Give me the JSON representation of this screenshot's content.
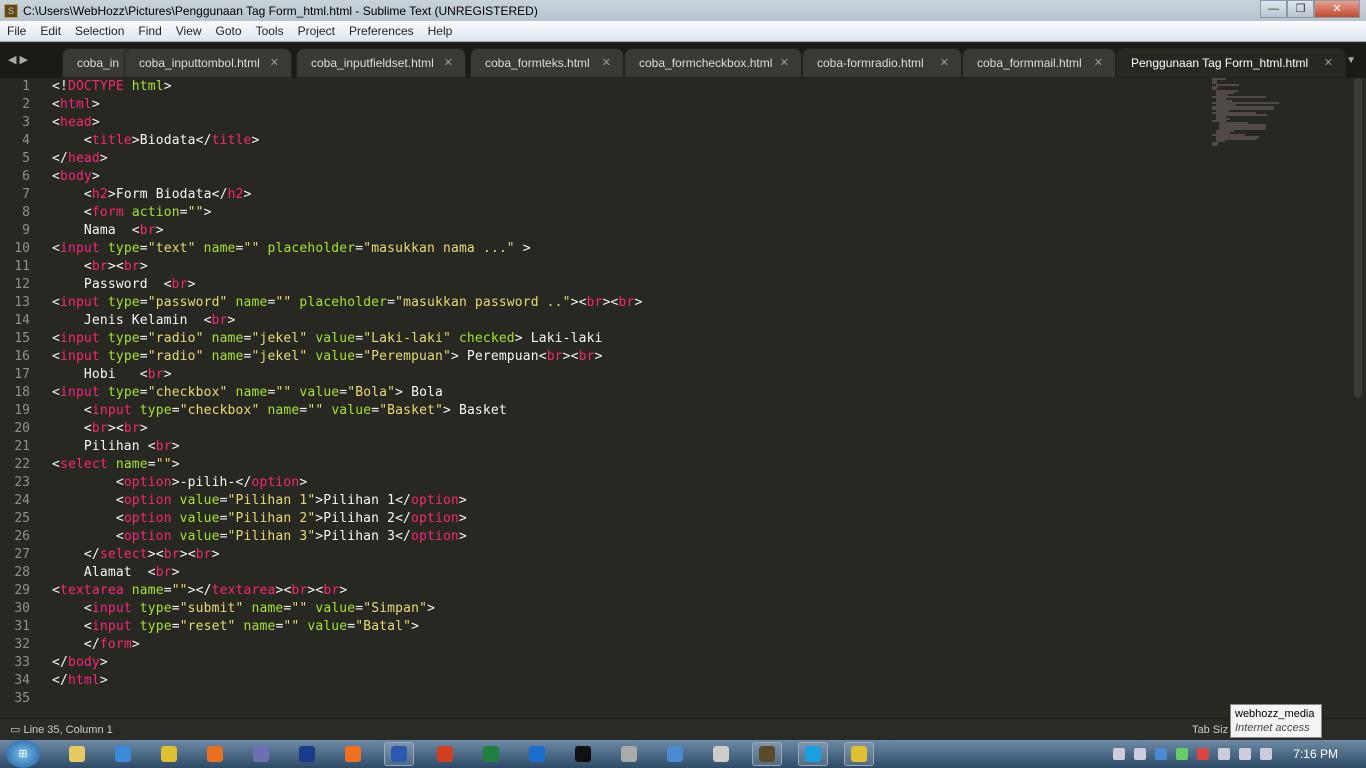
{
  "window": {
    "title": "C:\\Users\\WebHozz\\Pictures\\Penggunaan Tag Form_html.html - Sublime Text (UNREGISTERED)"
  },
  "menu": [
    "File",
    "Edit",
    "Selection",
    "Find",
    "View",
    "Goto",
    "Tools",
    "Project",
    "Preferences",
    "Help"
  ],
  "tabs": [
    {
      "label": "coba_in"
    },
    {
      "label": "coba_inputtombol.html"
    },
    {
      "label": "coba_inputfieldset.html"
    },
    {
      "label": "coba_formteks.html"
    },
    {
      "label": "coba_formcheckbox.html"
    },
    {
      "label": "coba-formradio.html"
    },
    {
      "label": "coba_formmail.html"
    },
    {
      "label": "Penggunaan Tag Form_html.html",
      "active": true
    }
  ],
  "code": [
    "<!DOCTYPE html>",
    "<html>",
    "<head>",
    "    <title>Biodata</title>",
    "</head>",
    "<body>",
    "    <h2>Form Biodata</h2>",
    "    <form action=\"\">",
    "    Nama  <br>",
    "<input type=\"text\" name=\"\" placeholder=\"masukkan nama ...\" >",
    "    <br><br>",
    "    Password  <br>",
    "<input type=\"password\" name=\"\" placeholder=\"masukkan password ..\"><br><br>",
    "    Jenis Kelamin  <br>",
    "<input type=\"radio\" name=\"jekel\" value=\"Laki-laki\" checked> Laki-laki",
    "<input type=\"radio\" name=\"jekel\" value=\"Perempuan\"> Perempuan<br><br>",
    "    Hobi   <br>",
    "<input type=\"checkbox\" name=\"\" value=\"Bola\"> Bola",
    "    <input type=\"checkbox\" name=\"\" value=\"Basket\"> Basket",
    "    <br><br>",
    "    Pilihan <br>",
    "<select name=\"\">",
    "        <option>-pilih-</option>",
    "        <option value=\"Pilihan 1\">Pilihan 1</option>",
    "        <option value=\"Pilihan 2\">Pilihan 2</option>",
    "        <option value=\"Pilihan 3\">Pilihan 3</option>",
    "    </select><br><br>",
    "    Alamat  <br>",
    "<textarea name=\"\"></textarea><br><br>",
    "    <input type=\"submit\" name=\"\" value=\"Simpan\">",
    "    <input type=\"reset\" name=\"\" value=\"Batal\">",
    "    </form>",
    "</body>",
    "</html>",
    ""
  ],
  "colors": {
    "tag": "#f92672",
    "attr": "#a6e22e",
    "string": "#e6db74",
    "text": "#f8f8f2",
    "background": "#272822"
  },
  "status": {
    "position": "Line 35, Column 1",
    "right": "Tab Siz"
  },
  "tooltip": {
    "title": "webhozz_media",
    "subtitle": "Internet access"
  },
  "taskbar": {
    "clock": "7:16 PM",
    "apps": [
      "explorer",
      "internet-explorer",
      "chrome",
      "firefox",
      "php",
      "photoshop",
      "xampp",
      "word",
      "powerpoint",
      "excel",
      "teamviewer",
      "cmd",
      "settings",
      "keyboard",
      "unity",
      "sublime-text",
      "skype",
      "chrome"
    ]
  }
}
